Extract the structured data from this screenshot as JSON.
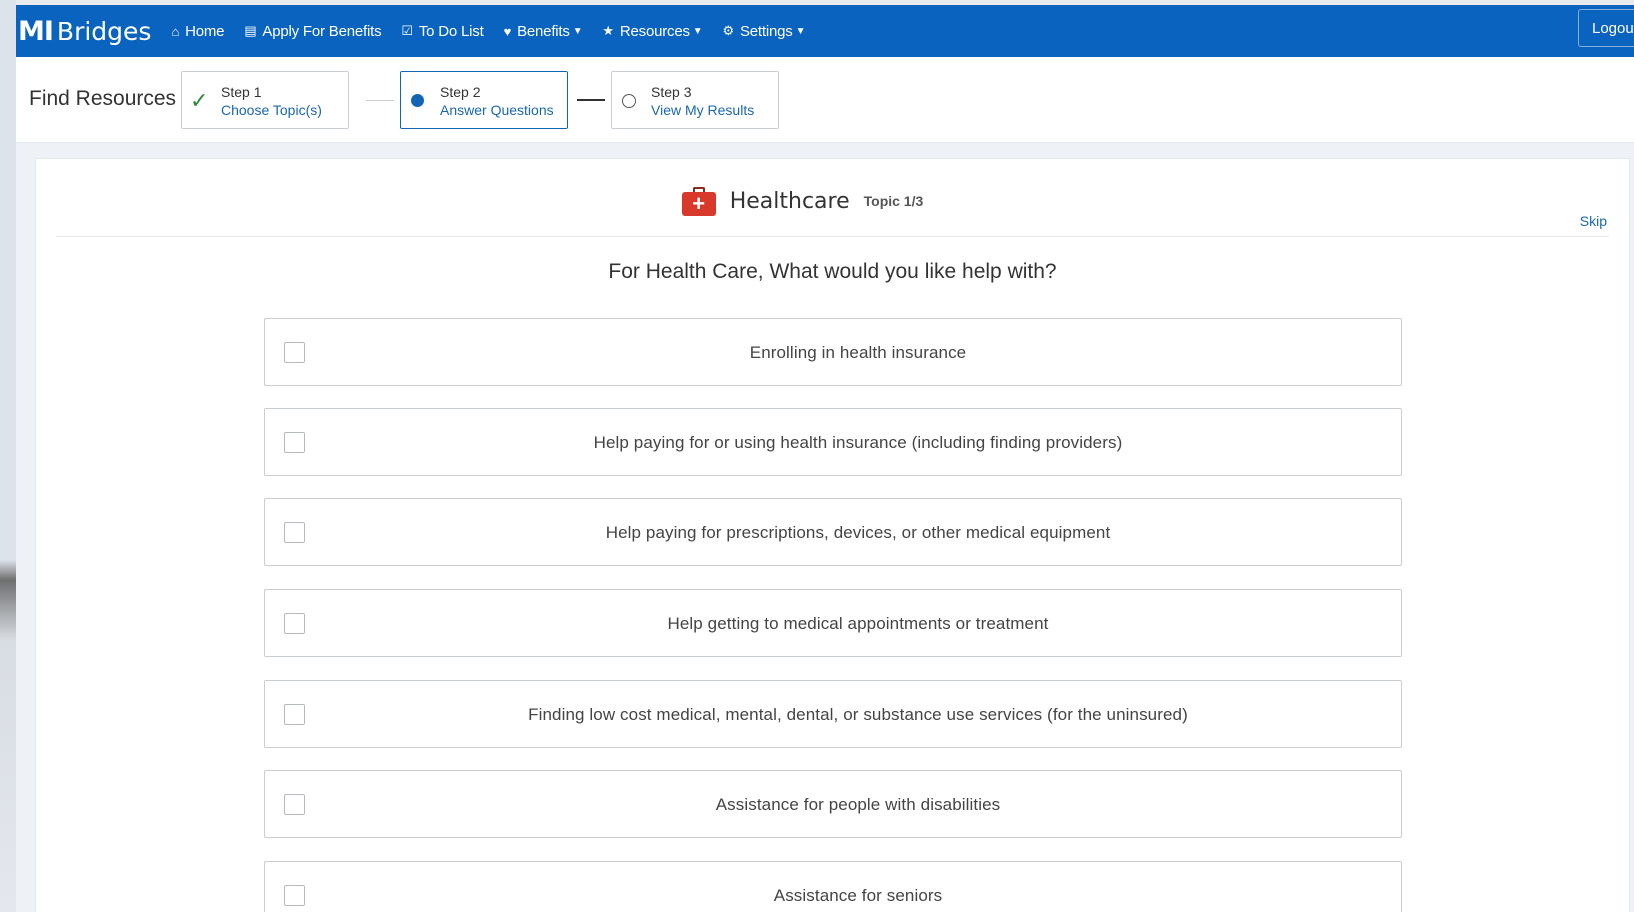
{
  "app": {
    "logo_mark": "MI",
    "logo_text": "Bridges"
  },
  "nav": {
    "items": [
      {
        "label": "Home",
        "icon": "home-icon",
        "glyph": "⌂",
        "dropdown": false
      },
      {
        "label": "Apply For Benefits",
        "icon": "document-icon",
        "glyph": "▤",
        "dropdown": false
      },
      {
        "label": "To Do List",
        "icon": "checklist-icon",
        "glyph": "☑",
        "dropdown": false
      },
      {
        "label": "Benefits",
        "icon": "heart-icon",
        "glyph": "♥",
        "dropdown": true
      },
      {
        "label": "Resources",
        "icon": "star-icon",
        "glyph": "★",
        "dropdown": true
      },
      {
        "label": "Settings",
        "icon": "gear-icon",
        "glyph": "⚙",
        "dropdown": true
      }
    ],
    "logout_label": "Logout"
  },
  "stepbar": {
    "title": "Find Resources",
    "steps": [
      {
        "label": "Step 1",
        "sub": "Choose Topic(s)",
        "state": "complete"
      },
      {
        "label": "Step 2",
        "sub": "Answer Questions",
        "state": "active"
      },
      {
        "label": "Step 3",
        "sub": "View My Results",
        "state": "pending"
      }
    ]
  },
  "topic": {
    "title": "Healthcare",
    "count": "Topic 1/3",
    "skip_label": "Skip",
    "question": "For Health Care, What would you like help with?",
    "options": [
      {
        "label": "Enrolling in health insurance",
        "checked": false
      },
      {
        "label": "Help paying for or using health insurance (including finding providers)",
        "checked": false
      },
      {
        "label": "Help paying for prescriptions, devices, or other medical equipment",
        "checked": false
      },
      {
        "label": "Help getting to medical appointments or treatment",
        "checked": false
      },
      {
        "label": "Finding low cost medical, mental, dental, or substance use services (for the uninsured)",
        "checked": false
      },
      {
        "label": "Assistance for people with disabilities",
        "checked": false
      },
      {
        "label": "Assistance for seniors",
        "checked": false
      }
    ]
  },
  "colors": {
    "brand": "#0a63be",
    "link": "#1a67b0",
    "check": "#2e8b38",
    "medkit": "#d9392b"
  }
}
